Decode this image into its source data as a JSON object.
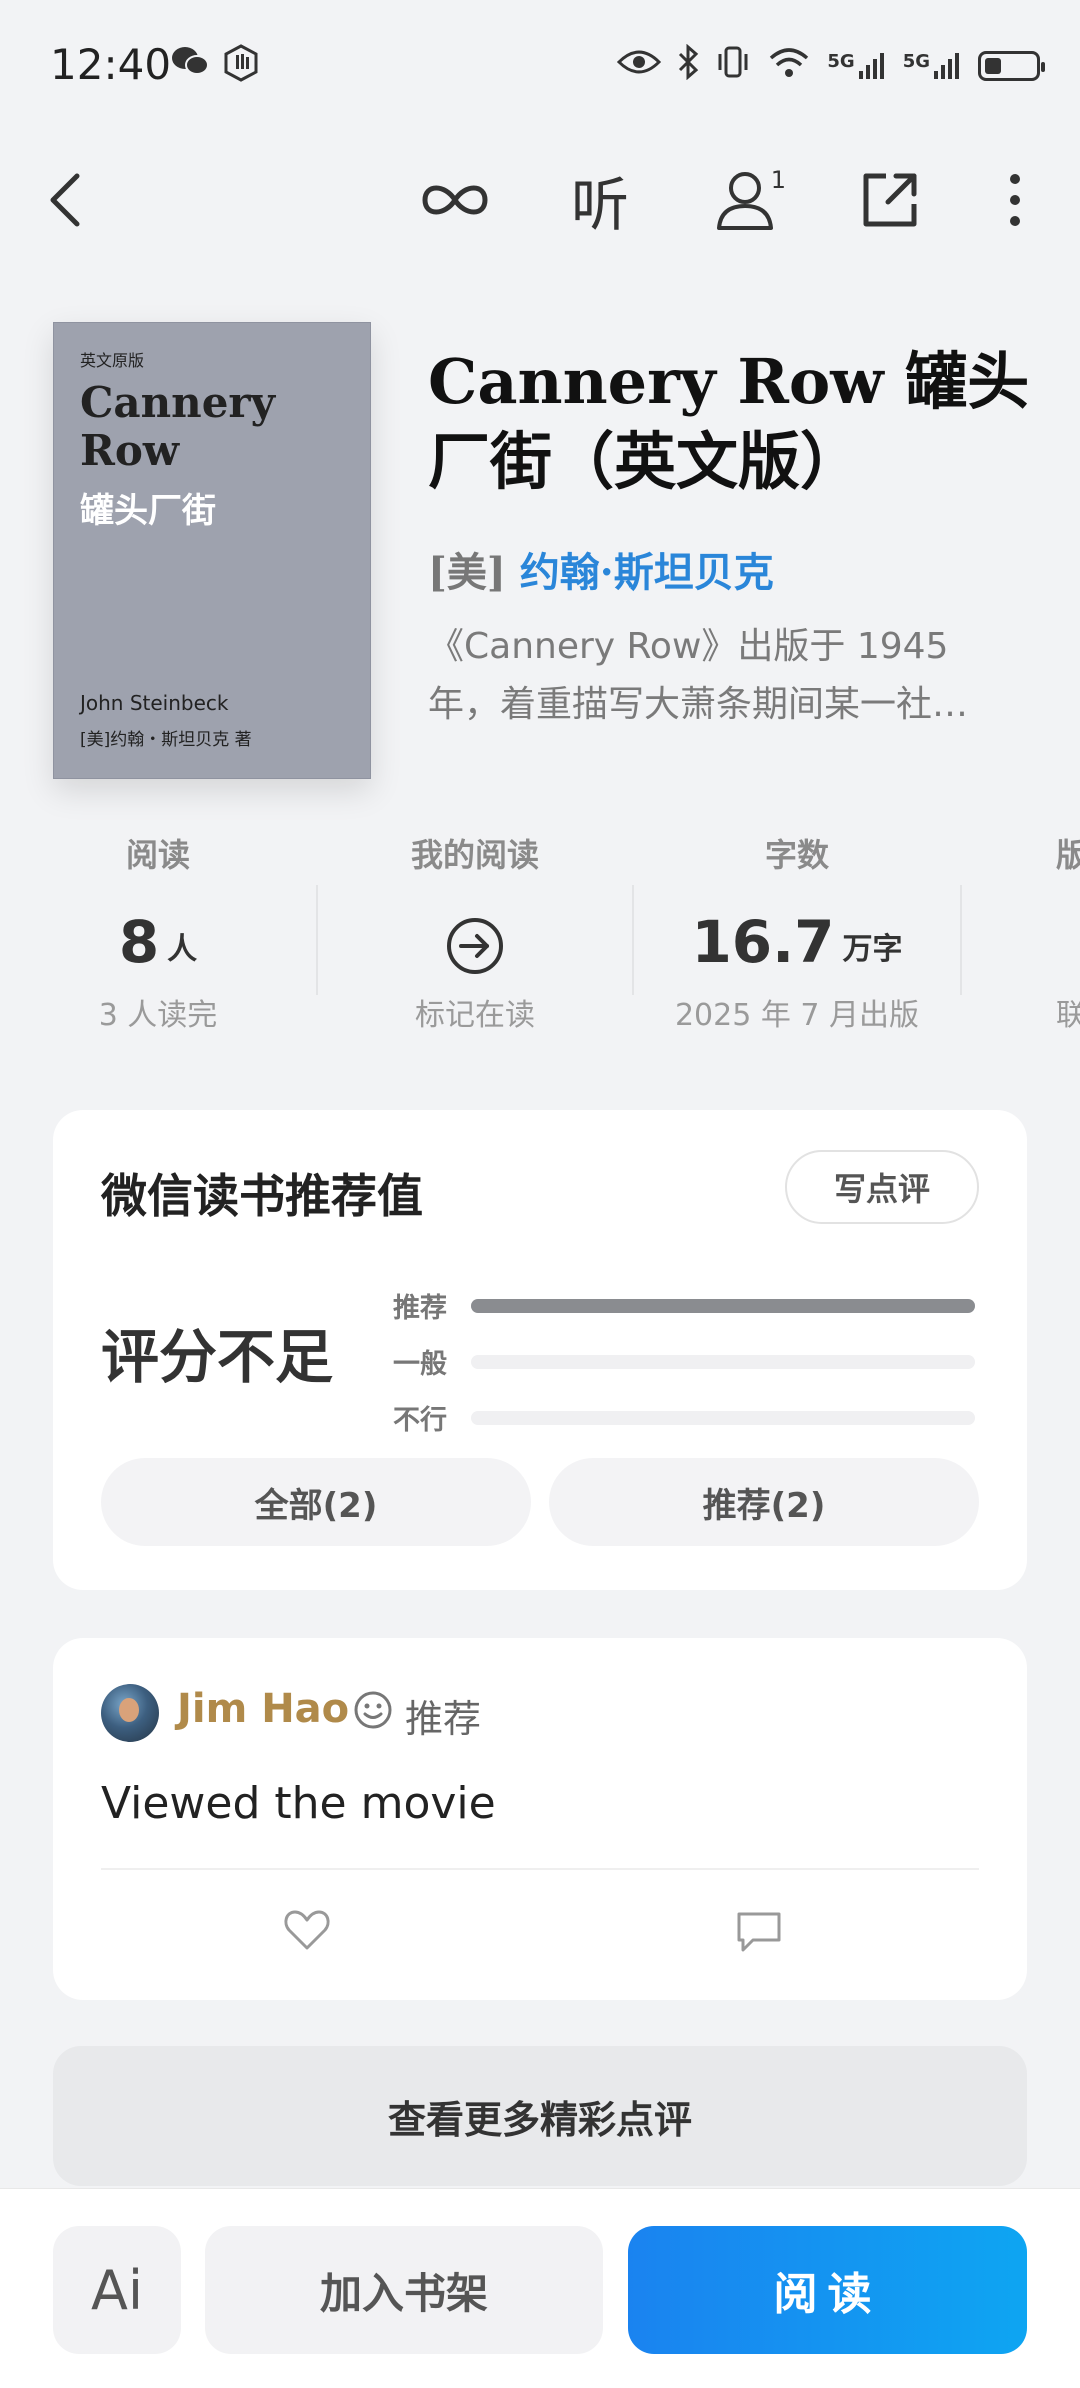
{
  "status_bar": {
    "time": "12:40",
    "network_1": "5G",
    "network_2": "5G"
  },
  "nav": {
    "badge_count": "1",
    "listen_label": "听"
  },
  "book": {
    "cover": {
      "edition": "英文原版",
      "title_line1": "Cannery",
      "title_line2": "Row",
      "subtitle": "罐头厂街",
      "author_en": "John Steinbeck",
      "author_cn": "[美]约翰・斯坦贝克 著"
    },
    "title": "Cannery Row 罐头厂街（英文版）",
    "author_prefix": "[美]",
    "author_name": "约翰·斯坦贝克",
    "description": "《Cannery Row》出版于 1945 年，着重描写大萧条期间某一社…"
  },
  "stats": [
    {
      "label": "阅读",
      "value": "8",
      "unit": "人",
      "sub": "3 人读完"
    },
    {
      "label": "我的阅读",
      "value": "",
      "unit": "",
      "sub": "标记在读"
    },
    {
      "label": "字数",
      "value": "16.7",
      "unit": "万字",
      "sub": "2025 年 7 月出版"
    },
    {
      "label": "版",
      "value": "",
      "unit": "",
      "sub": "联"
    }
  ],
  "rating_card": {
    "title": "微信读书推荐值",
    "write_button": "写点评",
    "score_text": "评分不足",
    "bars": [
      {
        "label": "推荐",
        "fraction": 1.0
      },
      {
        "label": "一般",
        "fraction": 0.0
      },
      {
        "label": "不行",
        "fraction": 0.0
      }
    ],
    "filter_all": "全部(2)",
    "filter_recommend": "推荐(2)"
  },
  "review": {
    "user": "Jim Hao",
    "verdict": "推荐",
    "text": "Viewed the movie"
  },
  "more_reviews_button": "查看更多精彩点评",
  "bottom_bar": {
    "ai_label": "Ai",
    "add_shelf": "加入书架",
    "read": "阅读"
  },
  "colors": {
    "accent_blue": "#1a83f0",
    "author_blue": "#2a86d9",
    "username_gold": "#b08a4a"
  }
}
